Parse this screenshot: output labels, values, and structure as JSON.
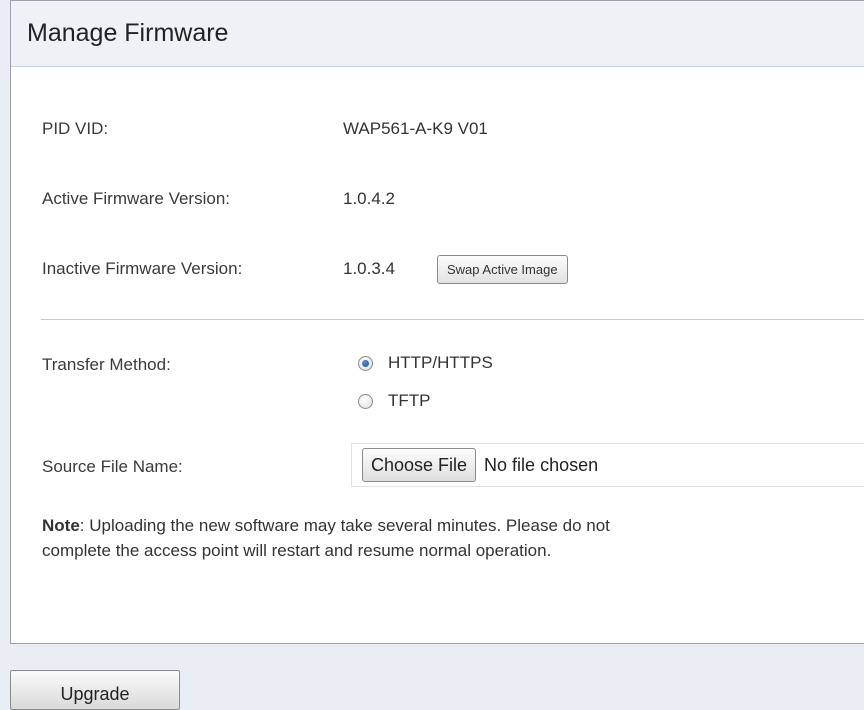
{
  "page": {
    "title": "Manage Firmware"
  },
  "info": {
    "pid_vid_label": "PID VID:",
    "pid_vid_value": "WAP561-A-K9 V01",
    "active_label": "Active Firmware Version:",
    "active_value": "1.0.4.2",
    "inactive_label": "Inactive Firmware Version:",
    "inactive_value": "1.0.3.4",
    "swap_button": "Swap Active Image"
  },
  "transfer": {
    "label": "Transfer Method:",
    "options": [
      {
        "label": "HTTP/HTTPS",
        "selected": true
      },
      {
        "label": "TFTP",
        "selected": false
      }
    ]
  },
  "source_file": {
    "label": "Source File Name:",
    "choose_button": "Choose File",
    "status": "No file chosen"
  },
  "note": {
    "label": "Note",
    "line1": ": Uploading the new software may take several minutes. Please do not",
    "line2": "complete the access point will restart and resume normal operation."
  },
  "actions": {
    "upgrade_button": "Upgrade"
  },
  "colors": {
    "title_bar_bg": "#eef2f7",
    "page_bg": "#e8eef4",
    "radio_selected": "#1f4f8f"
  }
}
